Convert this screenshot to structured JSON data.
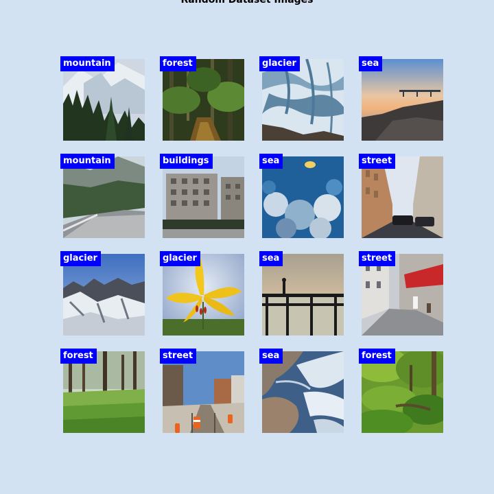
{
  "title": "Random Dataset Images",
  "colors": {
    "background": "#d3e2f2",
    "label_background": "#0000ff",
    "label_text": "#ffffff"
  },
  "grid": {
    "tiles": [
      {
        "label": "mountain",
        "scene": "snowy-mountain-pines"
      },
      {
        "label": "forest",
        "scene": "forest-stream"
      },
      {
        "label": "glacier",
        "scene": "glacier-crevasses"
      },
      {
        "label": "sea",
        "scene": "sunset-pier-shore"
      },
      {
        "label": "mountain",
        "scene": "mountain-road"
      },
      {
        "label": "buildings",
        "scene": "apartment-building"
      },
      {
        "label": "sea",
        "scene": "coral-reef"
      },
      {
        "label": "street",
        "scene": "city-street-cars"
      },
      {
        "label": "glacier",
        "scene": "snowy-ridge"
      },
      {
        "label": "glacier",
        "scene": "yellow-lily-flower"
      },
      {
        "label": "sea",
        "scene": "pier-silhouette"
      },
      {
        "label": "street",
        "scene": "cafe-street"
      },
      {
        "label": "forest",
        "scene": "pine-meadow"
      },
      {
        "label": "street",
        "scene": "construction-street"
      },
      {
        "label": "sea",
        "scene": "satellite-coast"
      },
      {
        "label": "forest",
        "scene": "green-forest"
      }
    ]
  }
}
